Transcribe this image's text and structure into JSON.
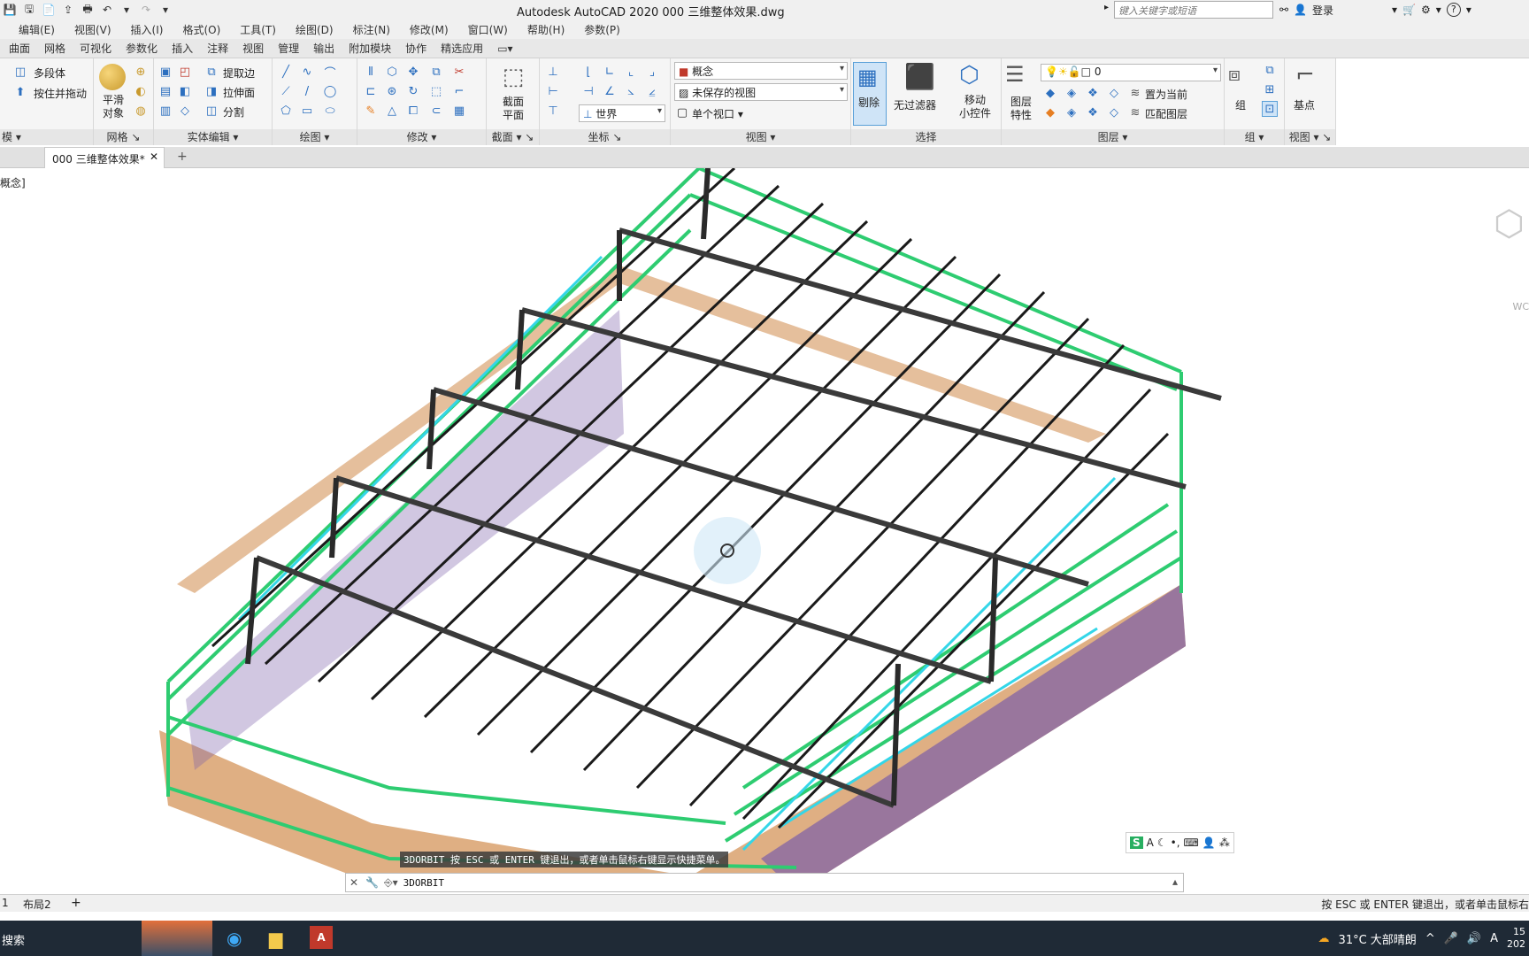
{
  "window": {
    "title": "Autodesk AutoCAD 2020    000 三维整体效果.dwg",
    "search_placeholder": "键入关键字或短语",
    "login": "登录"
  },
  "menu": [
    "编辑(E)",
    "视图(V)",
    "插入(I)",
    "格式(O)",
    "工具(T)",
    "绘图(D)",
    "标注(N)",
    "修改(M)",
    "窗口(W)",
    "帮助(H)",
    "参数(P)"
  ],
  "ribbon_tabs": [
    "曲面",
    "网格",
    "可视化",
    "参数化",
    "插入",
    "注释",
    "视图",
    "管理",
    "输出",
    "附加模块",
    "协作",
    "精选应用"
  ],
  "ribbon": {
    "modeling": {
      "title": "模",
      "polysolid": "多段体",
      "presspull": "按住并拖动"
    },
    "mesh": {
      "title": "网格",
      "smooth_line1": "平滑",
      "smooth_line2": "对象"
    },
    "solid_edit": {
      "title": "实体编辑",
      "extract": "提取边",
      "extrude_face": "拉伸面",
      "separate": "分割"
    },
    "draw": {
      "title": "绘图"
    },
    "modify": {
      "title": "修改"
    },
    "section": {
      "title": "截面",
      "plane_line1": "截面",
      "plane_line2": "平面"
    },
    "coords": {
      "title": "坐标",
      "world": "世界"
    },
    "view": {
      "title": "视图",
      "visual_style": "概念",
      "saved_view": "未保存的视图",
      "viewport": "单个视口"
    },
    "selection": {
      "title": "选择",
      "culling": "剔除",
      "no_filter": "无过滤器",
      "gizmo_line1": "移动",
      "gizmo_line2": "小控件"
    },
    "layers": {
      "title": "图层",
      "props_line1": "图层",
      "props_line2": "特性",
      "layer_name": "0",
      "make_current": "置为当前",
      "match_layer": "匹配图层"
    },
    "groups": {
      "title": "组",
      "group": "组"
    },
    "view2": {
      "title": "视图",
      "base": "基点"
    }
  },
  "document_tab": "000 三维整体效果*",
  "viewport_label": "概念]",
  "viewcube_label": "WC",
  "command": {
    "message": "3DORBIT 按 ESC 或 ENTER 键退出，或者单击鼠标右键显示快捷菜单。",
    "input": "3DORBIT"
  },
  "layout_tabs": [
    "1",
    "布局2"
  ],
  "status_text": "按 ESC 或 ENTER 键退出，或者单击鼠标右",
  "taskbar": {
    "search": "搜索",
    "weather": "31°C  大部晴朗",
    "clock": "15",
    "date": "202"
  },
  "ime": {
    "icon": "S",
    "mode": "A"
  }
}
